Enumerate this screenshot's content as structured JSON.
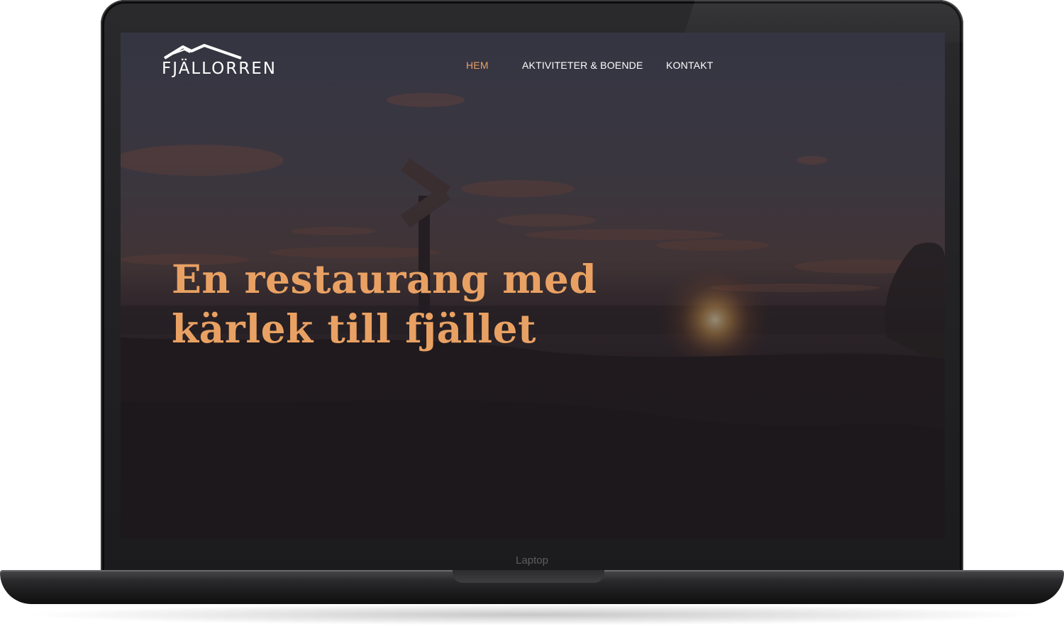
{
  "device": {
    "bezel_label": "Laptop"
  },
  "site": {
    "logo_text": "FJÄLLORREN",
    "nav": [
      {
        "label": "HEM",
        "active": true
      },
      {
        "label": "AKTIVITETER & BOENDE",
        "active": false
      },
      {
        "label": "KONTAKT",
        "active": false
      }
    ],
    "hero": {
      "headline_line1": "En restaurang med",
      "headline_line2": "kärlek till fjället"
    }
  },
  "colors": {
    "accent": "#e9a163",
    "nav_text": "#ffffff",
    "screen_bg": "#221d21"
  },
  "icons": {
    "logo_mark": "mountain-icon"
  }
}
